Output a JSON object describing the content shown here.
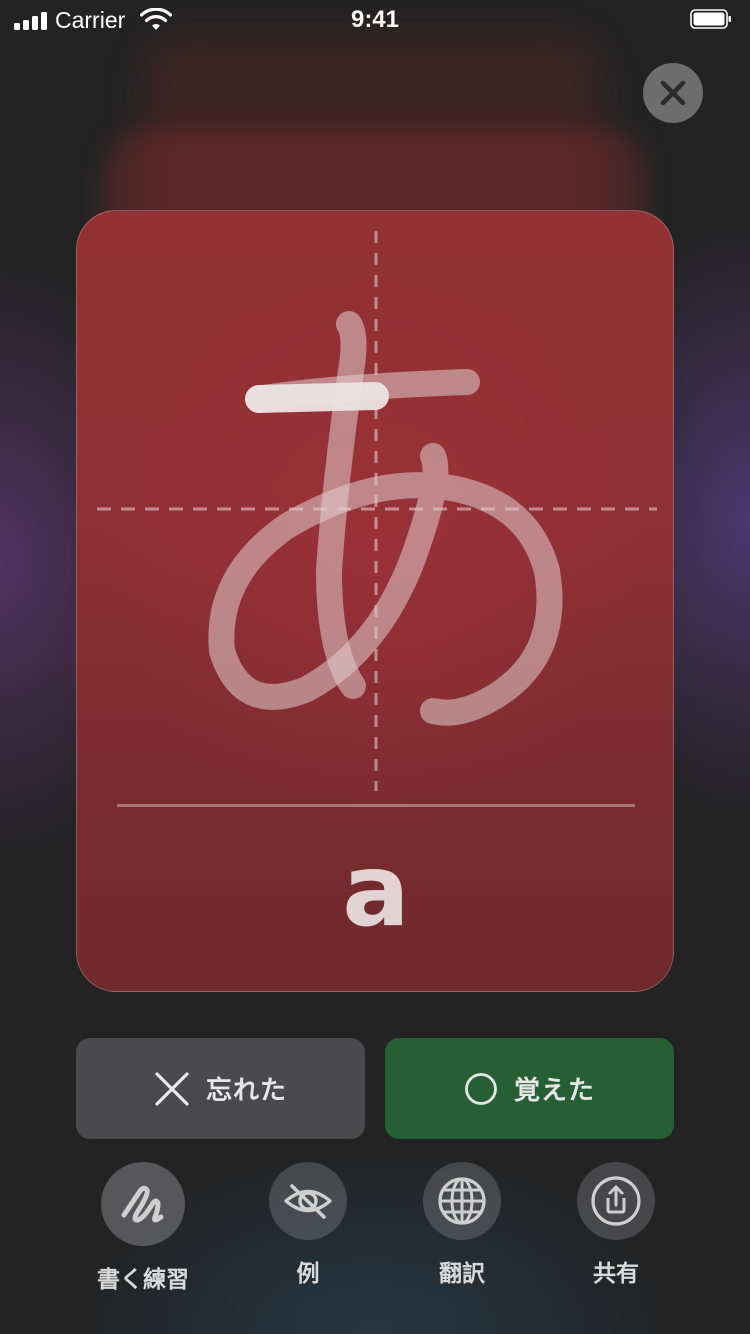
{
  "status_bar": {
    "carrier": "Carrier",
    "time": "9:41"
  },
  "icons": {
    "close": "close-icon",
    "signal": "signal-icon",
    "wifi": "wifi-icon",
    "battery": "battery-icon"
  },
  "card": {
    "character": "あ",
    "romaji": "a",
    "color": "#8e3034"
  },
  "actions": {
    "forgot_label": "忘れた",
    "known_label": "覚えた",
    "forgot_color": "#4a4a4c",
    "known_color": "#275f34"
  },
  "tools": [
    {
      "label": "書く練習",
      "icon": "handwriting-icon"
    },
    {
      "label": "例",
      "icon": "eye-slash-icon"
    },
    {
      "label": "翻訳",
      "icon": "globe-icon"
    },
    {
      "label": "共有",
      "icon": "share-icon"
    }
  ]
}
